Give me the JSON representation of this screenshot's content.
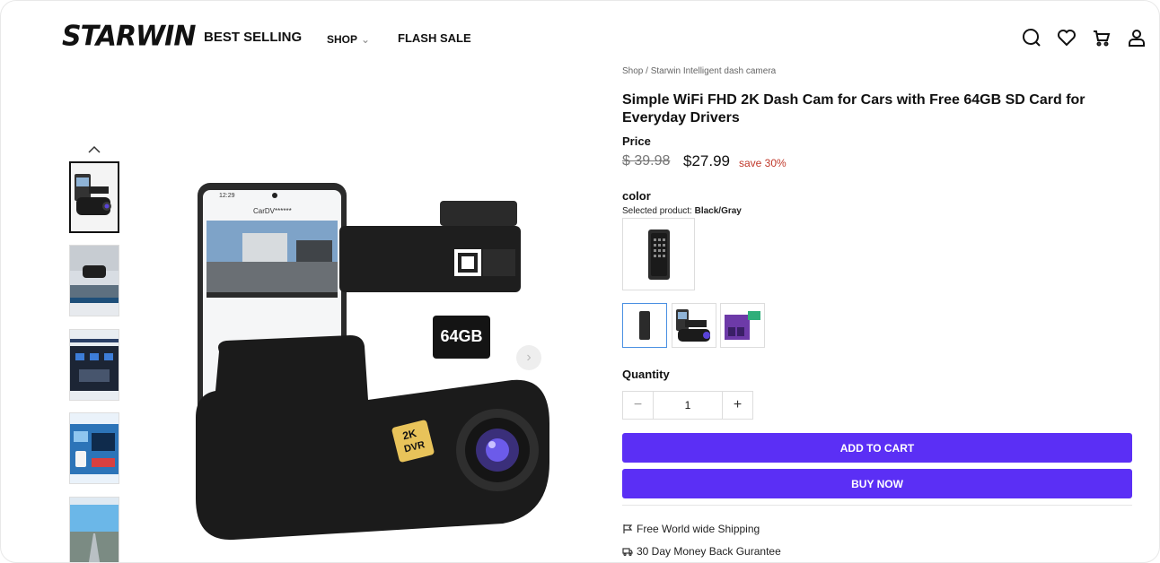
{
  "header": {
    "logo": "STARWIN",
    "nav": {
      "best_selling": "BEST SELLING",
      "shop": "SHOP",
      "flash_sale": "FLASH SALE"
    },
    "icons": [
      "search-icon",
      "heart-icon",
      "cart-icon",
      "user-icon"
    ]
  },
  "breadcrumb": "Shop / Starwin Intelligent dash camera",
  "product": {
    "title": "Simple WiFi FHD 2K Dash Cam for Cars with Free 64GB SD Card for Everyday Drivers",
    "price_label": "Price",
    "old_price": "$ 39.98",
    "new_price": "$27.99",
    "save": "save 30%",
    "color_label": "color",
    "selected_prefix": "Selected product:",
    "selected_value": "Black/Gray",
    "quantity_label": "Quantity",
    "quantity": "1",
    "add_to_cart": "ADD TO CART",
    "buy_now": "BUY NOW",
    "perks": [
      "Free World wide Shipping",
      "30 Day Money Back Gurantee"
    ]
  },
  "image_labels": {
    "phone_time": "12:29",
    "phone_app": "CarDV******",
    "sd_card": "64GB",
    "badge_top": "2K",
    "badge_bottom": "DVR"
  },
  "colors": {
    "accent": "#5b2ff5",
    "save_red": "#c0392b",
    "swatch_active": "#4a90e2"
  }
}
